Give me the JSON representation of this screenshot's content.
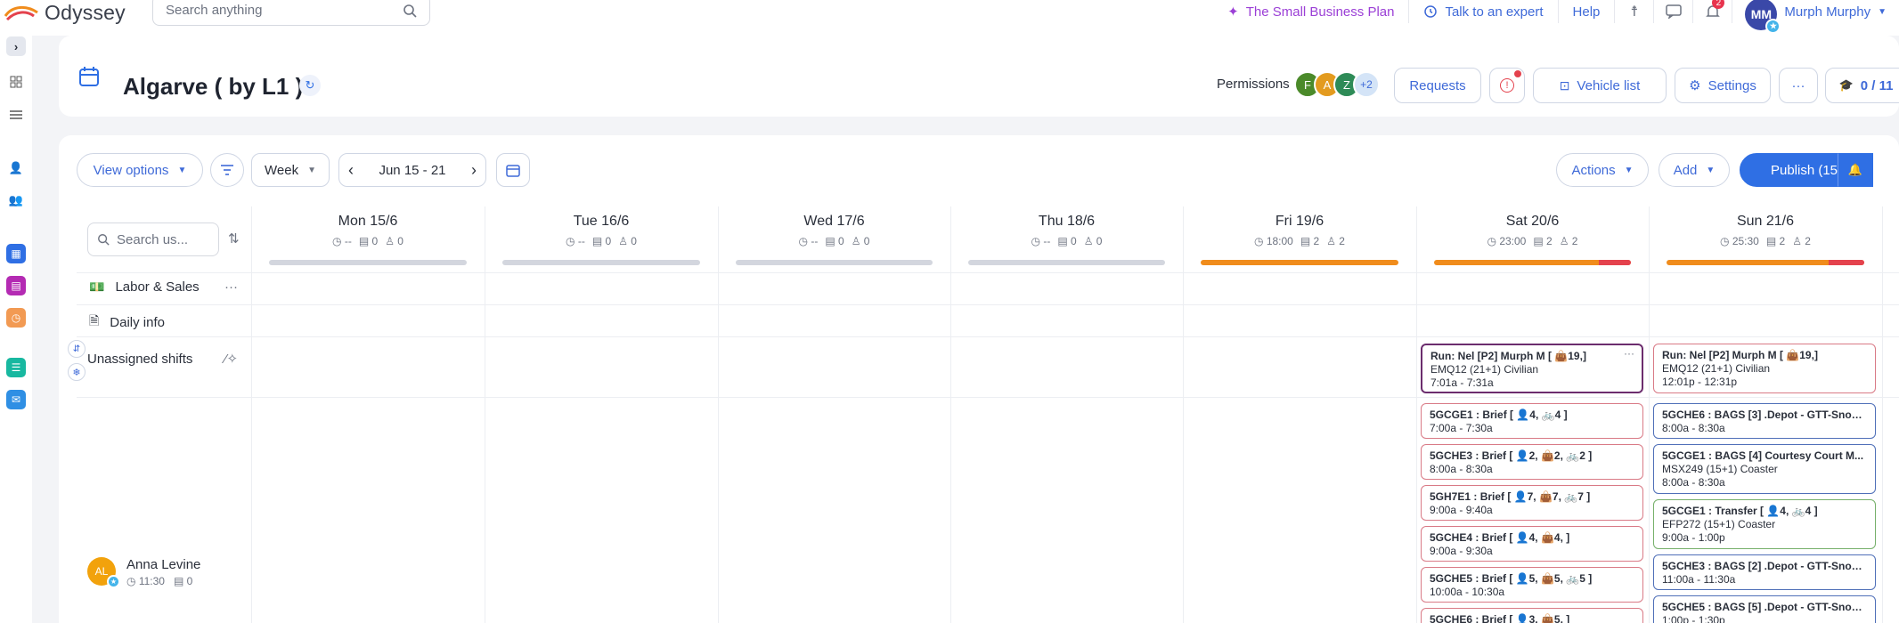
{
  "app": {
    "name": "Odyssey"
  },
  "search": {
    "placeholder": "Search anything"
  },
  "topnav": {
    "plan": "The Small Business Plan",
    "expert": "Talk to an expert",
    "help": "Help",
    "notifications_count": "2",
    "user_initials": "MM",
    "user_name": "Murph Murphy"
  },
  "header": {
    "title": "Algarve ( by L1 )",
    "permissions_label": "Permissions",
    "permission_avatars": [
      "F",
      "A",
      "Z"
    ],
    "permission_more": "+2",
    "requests": "Requests",
    "vehicle_list": "Vehicle list",
    "settings": "Settings",
    "counter": "0 / 11"
  },
  "toolbar": {
    "view_options": "View options",
    "week": "Week",
    "date_range": "Jun 15 - 21",
    "actions": "Actions",
    "add": "Add",
    "publish": "Publish (15)"
  },
  "grid": {
    "search_placeholder": "Search us...",
    "days": [
      {
        "name": "Mon 15/6",
        "hours": "--",
        "a": "0",
        "b": "0",
        "bar": "grey"
      },
      {
        "name": "Tue 16/6",
        "hours": "--",
        "a": "0",
        "b": "0",
        "bar": "grey"
      },
      {
        "name": "Wed 17/6",
        "hours": "--",
        "a": "0",
        "b": "0",
        "bar": "grey"
      },
      {
        "name": "Thu 18/6",
        "hours": "--",
        "a": "0",
        "b": "0",
        "bar": "grey"
      },
      {
        "name": "Fri 19/6",
        "hours": "18:00",
        "a": "2",
        "b": "2",
        "bar": "orange"
      },
      {
        "name": "Sat 20/6",
        "hours": "23:00",
        "a": "2",
        "b": "2",
        "bar": "orange-red"
      },
      {
        "name": "Sun 21/6",
        "hours": "25:30",
        "a": "2",
        "b": "2",
        "bar": "orange-red"
      }
    ],
    "rows": {
      "labor": "Labor & Sales",
      "daily": "Daily info",
      "unassigned": "Unassigned shifts"
    },
    "employee": {
      "initials": "AL",
      "name": "Anna Levine",
      "hours": "11:30",
      "count": "0"
    }
  },
  "shifts": {
    "sat_unassigned": {
      "title": "Run: Nel [P2] Murph M [ 👜19,]",
      "sub": "EMQ12 (21+1) Civilian",
      "time": "7:01a - 7:31a"
    },
    "sun_unassigned": {
      "title": "Run: Nel [P2] Murph M [ 👜19,]",
      "sub": "EMQ12 (21+1) Civilian",
      "time": "12:01p - 12:31p"
    },
    "sat": [
      {
        "title": "5GCGE1 : Brief [ 👤4, 🚲4 ]",
        "time": "7:00a - 7:30a"
      },
      {
        "title": "5GCHE3 : Brief [ 👤2, 👜2, 🚲2 ]",
        "time": "8:00a - 8:30a"
      },
      {
        "title": "5GH7E1 : Brief [ 👤7, 👜7, 🚲7 ]",
        "time": "9:00a - 9:40a"
      },
      {
        "title": "5GCHE4 : Brief [ 👤4, 👜4, ]",
        "time": "9:00a - 9:30a"
      },
      {
        "title": "5GCHE5 : Brief [ 👤5, 👜5, 🚲5 ]",
        "time": "10:00a - 10:30a"
      },
      {
        "title": "5GCHE6 : Brief [ 👤3, 👜5, ]",
        "time": ""
      }
    ],
    "sun": [
      {
        "title": "5GCHE6 : BAGS [3] .Depot - GTT-Snow...",
        "sub": "",
        "time": "8:00a - 8:30a",
        "color": "blue"
      },
      {
        "title": "5GCGE1 : BAGS [4] Courtesy Court M...",
        "sub": "MSX249 (15+1) Coaster",
        "time": "8:00a - 8:30a",
        "color": "blue"
      },
      {
        "title": "5GCGE1 : Transfer [ 👤4, 🚲4 ]",
        "sub": "EFP272 (15+1) Coaster",
        "time": "9:00a - 1:00p",
        "color": "green"
      },
      {
        "title": "5GCHE3 : BAGS [2] .Depot - GTT-Snow...",
        "sub": "",
        "time": "11:00a - 11:30a",
        "color": "blue"
      },
      {
        "title": "5GCHE5 : BAGS [5] .Depot - GTT-Snow...",
        "sub": "",
        "time": "1:00p - 1:30p",
        "color": "blue"
      }
    ]
  },
  "colors": {
    "accent": "#2f6fe4",
    "orange": "#f08c1c",
    "red": "#e4424d",
    "purple": "#9b3fd6"
  }
}
